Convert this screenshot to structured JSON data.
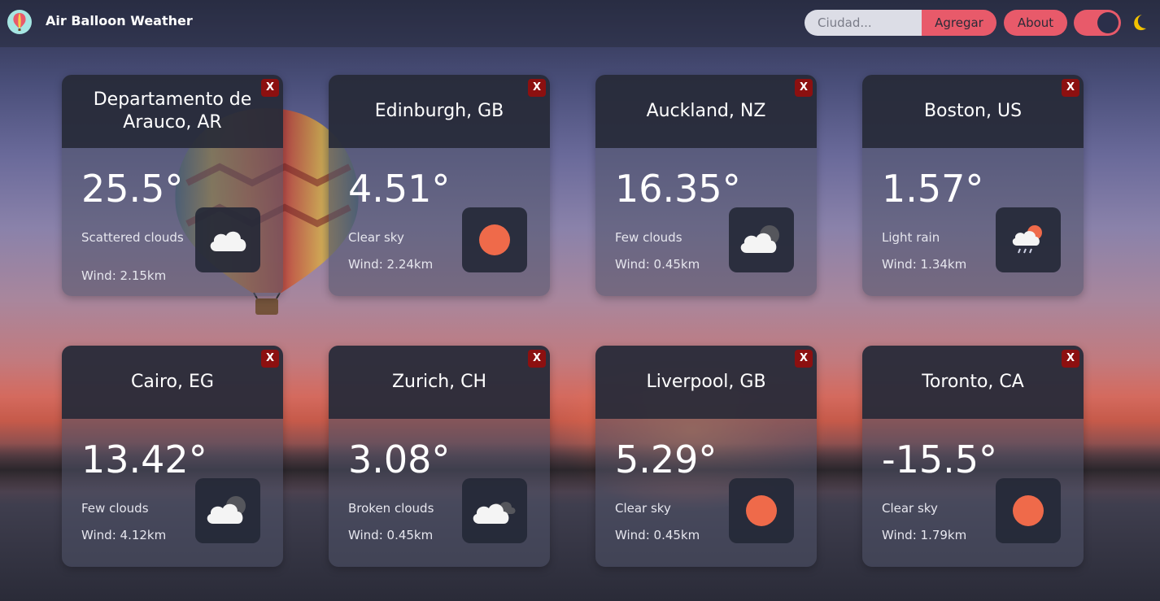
{
  "app": {
    "title": "Air Balloon Weather"
  },
  "header": {
    "search_placeholder": "Ciudad...",
    "add_label": "Agregar",
    "about_label": "About",
    "theme": "dark"
  },
  "colors": {
    "accent": "#e85a6a",
    "header_bg": "#242836",
    "close_bg": "#8c1010",
    "sun": "#ef6a4a"
  },
  "cards": [
    {
      "city": "Departamento de Arauco, AR",
      "temp": "25.5°",
      "desc": "Scattered clouds",
      "wind": "Wind: 2.15km",
      "icon": "cloud-icon",
      "close_label": "X"
    },
    {
      "city": "Edinburgh, GB",
      "temp": "4.51°",
      "desc": "Clear sky",
      "wind": "Wind: 2.24km",
      "icon": "sun-icon",
      "close_label": "X"
    },
    {
      "city": "Auckland, NZ",
      "temp": "16.35°",
      "desc": "Few clouds",
      "wind": "Wind: 0.45km",
      "icon": "few-clouds-icon",
      "close_label": "X"
    },
    {
      "city": "Boston, US",
      "temp": "1.57°",
      "desc": "Light rain",
      "wind": "Wind: 1.34km",
      "icon": "light-rain-icon",
      "close_label": "X"
    },
    {
      "city": "Cairo, EG",
      "temp": "13.42°",
      "desc": "Few clouds",
      "wind": "Wind: 4.12km",
      "icon": "few-clouds-icon",
      "close_label": "X"
    },
    {
      "city": "Zurich, CH",
      "temp": "3.08°",
      "desc": "Broken clouds",
      "wind": "Wind: 0.45km",
      "icon": "broken-clouds-icon",
      "close_label": "X"
    },
    {
      "city": "Liverpool, GB",
      "temp": "5.29°",
      "desc": "Clear sky",
      "wind": "Wind: 0.45km",
      "icon": "sun-icon",
      "close_label": "X"
    },
    {
      "city": "Toronto, CA",
      "temp": "-15.5°",
      "desc": "Clear sky",
      "wind": "Wind: 1.79km",
      "icon": "sun-icon",
      "close_label": "X"
    }
  ]
}
